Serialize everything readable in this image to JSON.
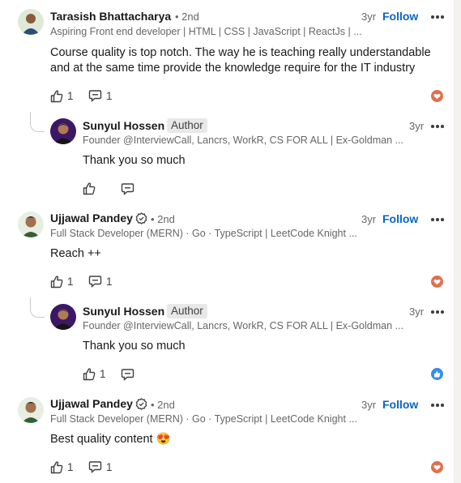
{
  "comments": [
    {
      "name": "Tarasish Bhattacharya",
      "degree": "• 2nd",
      "headline": "Aspiring Front end developer | HTML | CSS | JavaScript | ReactJs | ...",
      "time": "3yr",
      "follow": "Follow",
      "text_line1": "Course quality is top notch. The way he is teaching really understandable",
      "text_line2": "and at the same time provide the knowledge require for the IT industry",
      "likes": "1",
      "replies": "1",
      "reaction": "love-reaction-icon",
      "reply": {
        "name": "Sunyul Hossen",
        "badge": "Author",
        "headline": "Founder @InterviewCall, Lancrs, WorkR, CS FOR ALL | Ex-Goldman ...",
        "time": "3yr",
        "text": "Thank you so much"
      }
    },
    {
      "name": "Ujjawal Pandey",
      "degree": "• 2nd",
      "headline": "Full Stack Developer (MERN) · Go · TypeScript | LeetCode Knight ...",
      "time": "3yr",
      "follow": "Follow",
      "text": "Reach ++",
      "likes": "1",
      "replies": "1",
      "reaction": "love-reaction-icon",
      "reply": {
        "name": "Sunyul Hossen",
        "badge": "Author",
        "headline": "Founder @InterviewCall, Lancrs, WorkR, CS FOR ALL | Ex-Goldman ...",
        "time": "3yr",
        "text": "Thank you so much",
        "likes": "1",
        "reaction": "like-reaction-icon"
      }
    },
    {
      "name": "Ujjawal Pandey",
      "degree": "• 2nd",
      "headline": "Full Stack Developer (MERN) · Go · TypeScript | LeetCode Knight ...",
      "time": "3yr",
      "follow": "Follow",
      "text": "Best quality content 😍",
      "likes": "1",
      "replies": "1",
      "reaction": "love-reaction-icon"
    }
  ],
  "colors": {
    "follow": "#0a66c2",
    "love": "#df704d",
    "like": "#378fe9"
  }
}
